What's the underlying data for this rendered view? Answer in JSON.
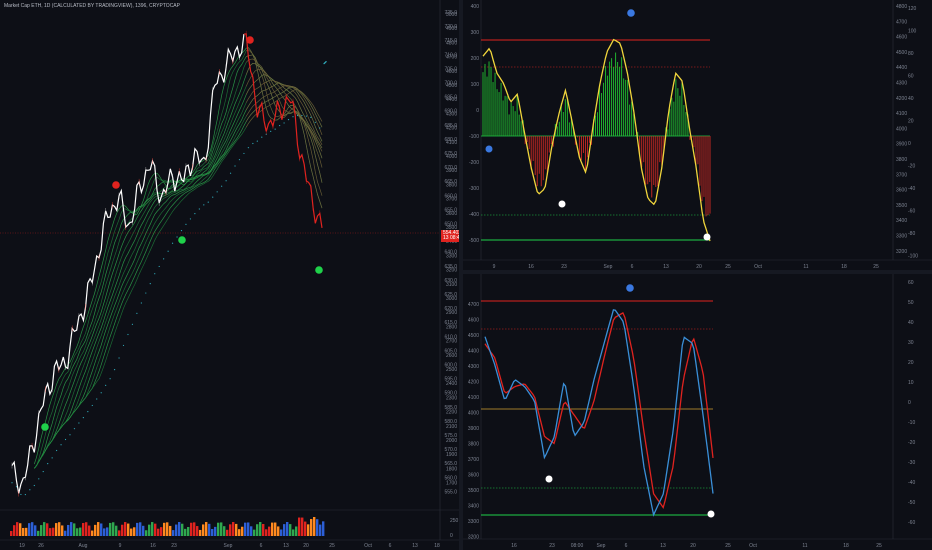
{
  "left_chart": {
    "title": "Market Cap ETH, 1D (CALCULATED BY TRADINGVIEW), 1396, CRYPTOCAP",
    "price_label_1": "554.4028",
    "price_label_2": "13 08:41",
    "right_axis": [
      "725.0",
      "720.0",
      "715.0",
      "710.0",
      "705.0",
      "700.0",
      "695.0",
      "690.0",
      "685.0",
      "680.0",
      "675.0",
      "670.0",
      "665.0",
      "660.0",
      "655.0",
      "650.0",
      "645.0",
      "640.0",
      "635.0",
      "630.0",
      "625.0",
      "620.0",
      "615.0",
      "610.0",
      "605.0",
      "600.0",
      "595.0",
      "590.0",
      "585.0",
      "580.0",
      "575.0",
      "570.0",
      "565.0",
      "560.0",
      "555.0"
    ],
    "mid_axis": [
      "5000",
      "4900",
      "4800",
      "4700",
      "4600",
      "4500",
      "4400",
      "4300",
      "4200",
      "4100",
      "4000",
      "3900",
      "3800",
      "3700",
      "3600",
      "3500",
      "3400",
      "3300",
      "3200",
      "3100",
      "3000",
      "2900",
      "2800",
      "2700",
      "2600",
      "2500",
      "2400",
      "2300",
      "2200",
      "2100",
      "2000",
      "1900",
      "1800",
      "1700"
    ],
    "volume_axis": [
      "250",
      "0"
    ],
    "x_axis": [
      "19",
      "26",
      "Aug",
      "9",
      "16",
      "23",
      "Sep",
      "6",
      "13",
      "20",
      "25",
      "Oct",
      "6",
      "13",
      "18"
    ],
    "colors": {
      "up": "#1fd14a",
      "down": "#e0231f",
      "price": "#ffffff",
      "ribbon_up": "#2fa84f",
      "ribbon_down": "#c43a34",
      "trail": "#2fa8b8",
      "hline": "#e0231f"
    }
  },
  "top_right": {
    "left_axis": [
      "400",
      "300",
      "200",
      "100",
      "0",
      "-100",
      "-200",
      "-300",
      "-400",
      "-500"
    ],
    "right_axis": [
      "120",
      "100",
      "80",
      "60",
      "40",
      "20",
      "0",
      "-20",
      "-40",
      "-60",
      "-80",
      "-100"
    ],
    "mid_axis": [
      "4800",
      "4700",
      "4600",
      "4500",
      "4400",
      "4300",
      "4200",
      "4100",
      "4000",
      "3900",
      "3800",
      "3700",
      "3600",
      "3500",
      "3400",
      "3300",
      "3200"
    ],
    "x_axis": [
      "9",
      "16",
      "23",
      "Sep",
      "6",
      "13",
      "20",
      "25",
      "Oct",
      "11",
      "18",
      "25"
    ],
    "colors": {
      "line": "#f0d53c",
      "hist_up": "#22c431",
      "hist_down": "#d12a24",
      "upper": "#e0231f",
      "lower": "#1fd14a"
    }
  },
  "bottom_right": {
    "left_axis": [
      "4700",
      "4600",
      "4500",
      "4400",
      "4300",
      "4200",
      "4100",
      "4000",
      "3900",
      "3800",
      "3700",
      "3600",
      "3500",
      "3400",
      "3300",
      "3200"
    ],
    "right_axis": [
      "60",
      "50",
      "40",
      "30",
      "20",
      "10",
      "0",
      "-10",
      "-20",
      "-30",
      "-40",
      "-50",
      "-60"
    ],
    "x_axis": [
      "16",
      "23",
      "08:00",
      "Sep",
      "6",
      "13",
      "20",
      "25",
      "Oct",
      "11",
      "18",
      "25"
    ],
    "colors": {
      "fast": "#3a8fd8",
      "slow": "#e0231f",
      "upper": "#e0231f",
      "mid": "#d0a030",
      "lower": "#1fd14a"
    }
  },
  "chart_data": [
    {
      "type": "line",
      "title": "Market Cap ETH, 1D (CALCULATED BY TRADINGVIEW), 1396, CRYPTOCAP",
      "x": [
        "Jul 19",
        "Jul 26",
        "Aug 2",
        "Aug 9",
        "Aug 16",
        "Aug 23",
        "Aug 30",
        "Sep 6",
        "Sep 13",
        "Sep 20"
      ],
      "series": [
        {
          "values": [
            560,
            590,
            615,
            655,
            665,
            668,
            682,
            710,
            690,
            655
          ]
        }
      ],
      "ylim": [
        555,
        725
      ],
      "grid": false
    },
    {
      "type": "line",
      "x": [
        "Aug 9",
        "Aug 16",
        "Aug 23",
        "Aug 30",
        "Sep 6",
        "Sep 13",
        "Sep 20"
      ],
      "series": [
        {
          "values": [
            350,
            150,
            -250,
            100,
            480,
            -300,
            200,
            -480
          ]
        }
      ],
      "ylim": [
        -520,
        460
      ]
    },
    {
      "type": "line",
      "x": [
        "Aug 16",
        "Aug 23",
        "Aug 30",
        "Sep 6",
        "Sep 13",
        "Sep 20"
      ],
      "series": [
        {
          "values": [
            4300,
            4150,
            3850,
            4100,
            4650,
            3300,
            4500,
            3400
          ]
        },
        {
          "values": [
            4250,
            4200,
            3900,
            4000,
            4600,
            3400,
            4450,
            3600
          ]
        }
      ],
      "ylim": [
        3200,
        4750
      ]
    }
  ]
}
